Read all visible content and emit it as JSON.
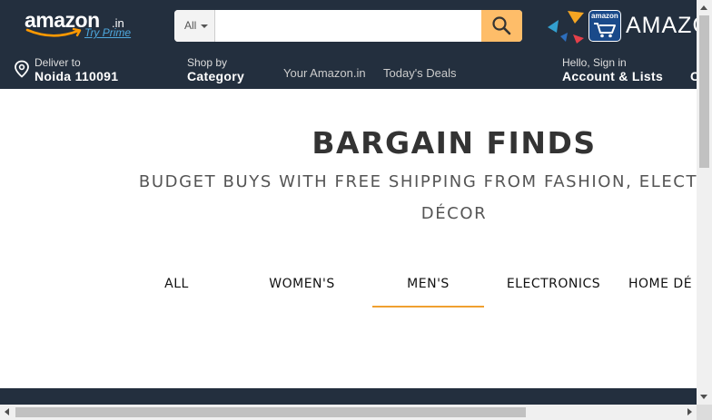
{
  "header": {
    "logo_text": "amazon",
    "logo_suffix": ".in",
    "logo_prime": "Try Prime",
    "search": {
      "category": "All",
      "placeholder": ""
    },
    "promo_text": "AMAZO",
    "promo_badge": "amazon"
  },
  "nav": {
    "deliver_label": "Deliver to",
    "deliver_location": "Noida 110091",
    "shop_by_label": "Shop by",
    "shop_by_value": "Category",
    "links": [
      "Your Amazon.in",
      "Today's Deals"
    ],
    "account_label": "Hello, Sign in",
    "account_value": "Account & Lists",
    "cut_off": "C"
  },
  "main": {
    "title": "BARGAIN FINDS",
    "subtitle_line1": "BUDGET BUYS WITH FREE SHIPPING FROM FASHION, ELECTRONICS",
    "subtitle_line2": "DÉCOR",
    "tabs": [
      {
        "label": "ALL",
        "active": false
      },
      {
        "label": "WOMEN'S",
        "active": false
      },
      {
        "label": "MEN'S",
        "active": true
      },
      {
        "label": "ELECTRONICS",
        "active": false
      },
      {
        "label": "HOME DÉ",
        "active": false
      }
    ]
  },
  "colors": {
    "header_bg": "#232f3e",
    "search_button": "#febd69",
    "active_tab_underline": "#f0a030",
    "prime_link": "#4ea8de"
  },
  "icons": [
    "map-pin-icon",
    "search-icon",
    "caret-down-icon",
    "shopping-cart-icon"
  ]
}
